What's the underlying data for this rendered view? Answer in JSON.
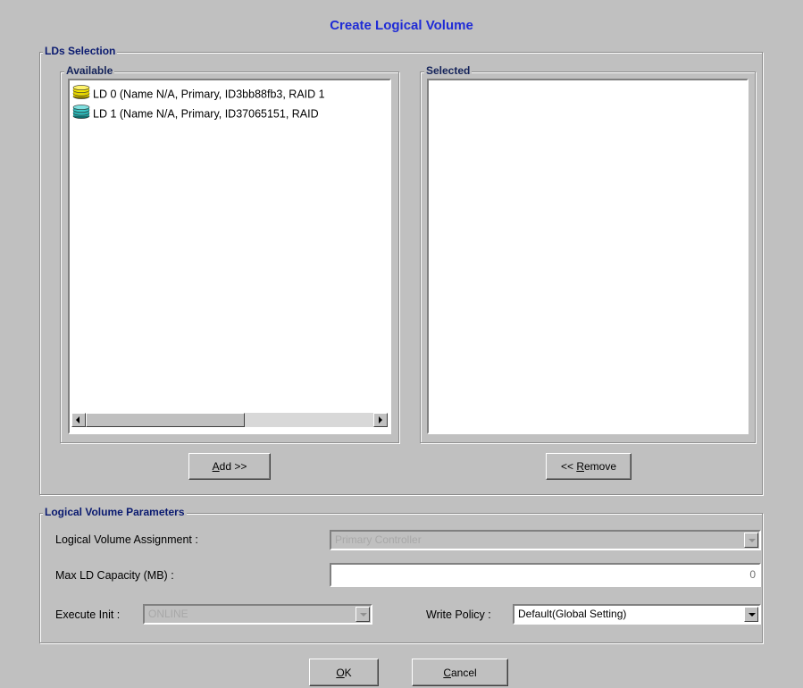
{
  "dialog": {
    "title": "Create Logical Volume"
  },
  "lds_selection": {
    "legend": "LDs Selection",
    "available": {
      "legend": "Available",
      "items": [
        {
          "label": "LD 0 (Name N/A, Primary, ID3bb88fb3, RAID 1",
          "icon": "yellow-disk-stack-icon",
          "color": "#e8d400"
        },
        {
          "label": "LD 1 (Name N/A, Primary, ID37065151, RAID",
          "icon": "cyan-disk-stack-icon",
          "color": "#2fb8b8"
        }
      ]
    },
    "selected": {
      "legend": "Selected",
      "items": []
    },
    "add_button": {
      "label": "Add >>",
      "mnemonic": "A",
      "rest": "dd >>"
    },
    "remove_button": {
      "label": "<< Remove",
      "prefix": "<< ",
      "mnemonic": "R",
      "rest": "emove"
    }
  },
  "parameters": {
    "legend": "Logical Volume Parameters",
    "assignment": {
      "label": "Logical Volume Assignment :",
      "value": "Primary Controller"
    },
    "capacity": {
      "label": "Max LD Capacity (MB) :",
      "value": "0"
    },
    "execute_init": {
      "label": "Execute Init :",
      "value": "ONLINE"
    },
    "write_policy": {
      "label": "Write Policy :",
      "value": "Default(Global Setting)"
    }
  },
  "buttons": {
    "ok": {
      "label": "OK",
      "mnemonic": "O",
      "rest": "K"
    },
    "cancel": {
      "label": "Cancel",
      "mnemonic": "C",
      "rest": "ancel"
    }
  },
  "colors": {
    "title": "#1f2bd6",
    "background": "#c0c0c0"
  }
}
